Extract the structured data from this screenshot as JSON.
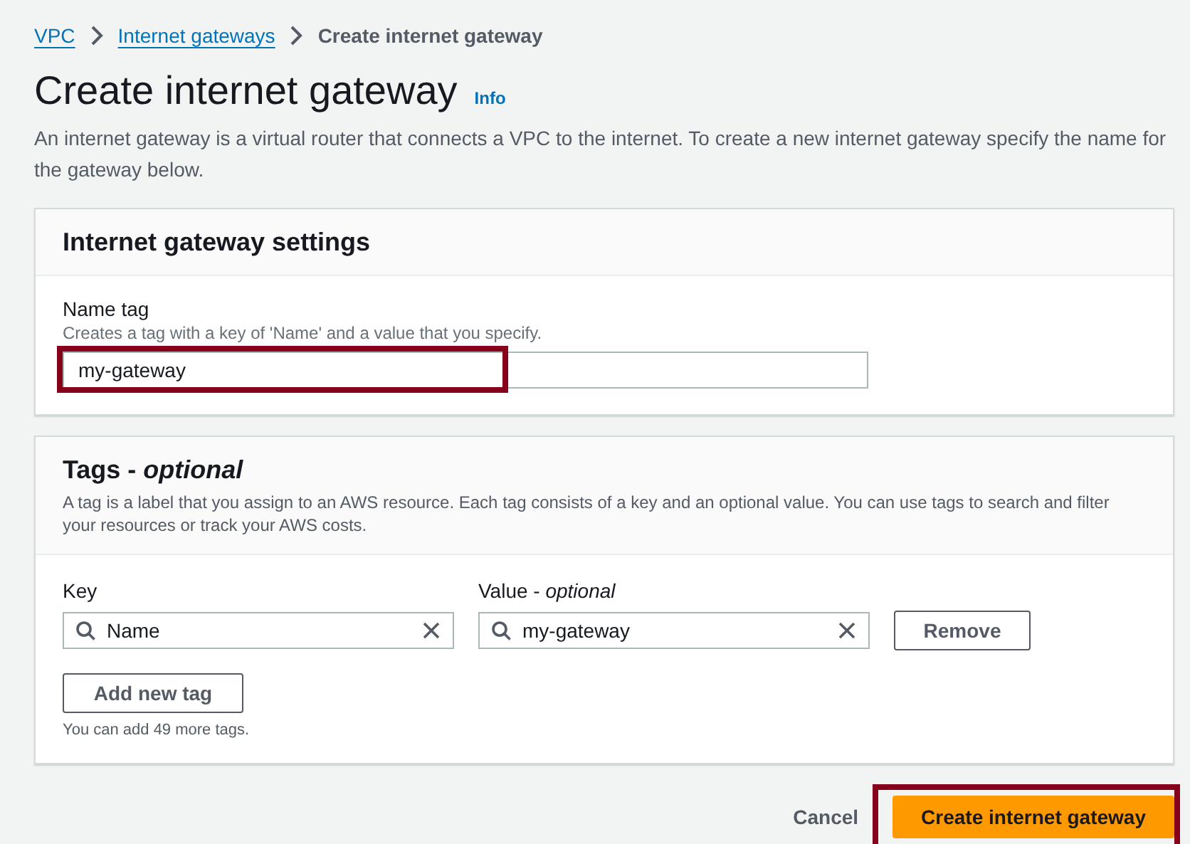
{
  "breadcrumb": [
    {
      "label": "VPC",
      "kind": "link"
    },
    {
      "label": "Internet gateways",
      "kind": "link"
    },
    {
      "label": "Create internet gateway",
      "kind": "current"
    }
  ],
  "page": {
    "title": "Create internet gateway",
    "info_link": "Info",
    "description": "An internet gateway is a virtual router that connects a VPC to the internet. To create a new internet gateway specify the name for the gateway below."
  },
  "settings_panel": {
    "title": "Internet gateway settings",
    "name_tag": {
      "label": "Name tag",
      "hint": "Creates a tag with a key of 'Name' and a value that you specify.",
      "value": "my-gateway",
      "highlighted": true
    }
  },
  "tags_panel": {
    "title": "Tags - *optional*",
    "description": "A tag is a label that you assign to an AWS resource. Each tag consists of a key and an optional value. You can use tags to search and filter your resources or track your AWS costs.",
    "key_label": "Key",
    "value_label": "Value - *optional*",
    "tags": [
      {
        "key": "Name",
        "value": "my-gateway"
      }
    ],
    "remove_button": "Remove",
    "add_button": "Add new tag",
    "limit_note": "You can add 49 more tags."
  },
  "actions": {
    "cancel": "Cancel",
    "submit": {
      "label": "Create internet gateway",
      "highlighted": true
    }
  }
}
